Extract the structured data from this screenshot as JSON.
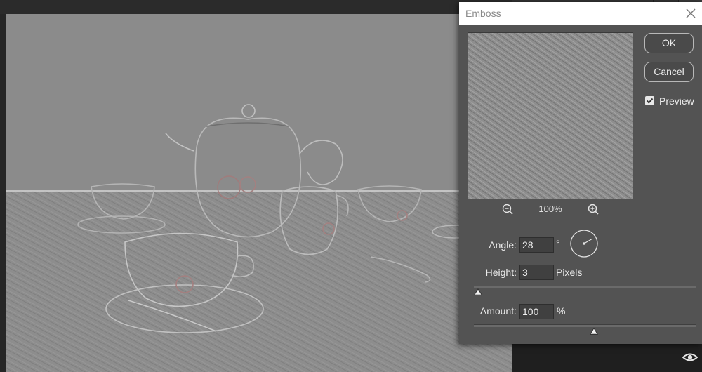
{
  "dialog": {
    "title": "Emboss",
    "ok_label": "OK",
    "cancel_label": "Cancel",
    "preview_label": "Preview",
    "preview_checked": true,
    "zoom": "100%",
    "angle": {
      "label": "Angle:",
      "value": "28",
      "unit": "°"
    },
    "height": {
      "label": "Height:",
      "value": "3",
      "unit": "Pixels"
    },
    "amount": {
      "label": "Amount:",
      "value": "100",
      "unit": "%"
    },
    "height_slider_level": 0.02,
    "amount_slider_level": 0.54
  },
  "icons": {
    "close": "close-icon",
    "zoom_out": "zoom-out-icon",
    "zoom_in": "zoom-in-icon",
    "angle_dial": "angle-dial-icon",
    "checkbox": "checkmark-icon",
    "layer_visibility": "eye-icon"
  },
  "colors": {
    "canvas_gray": "#8d8d8d",
    "dialog_bg": "#535353",
    "app_bg": "#262626"
  }
}
